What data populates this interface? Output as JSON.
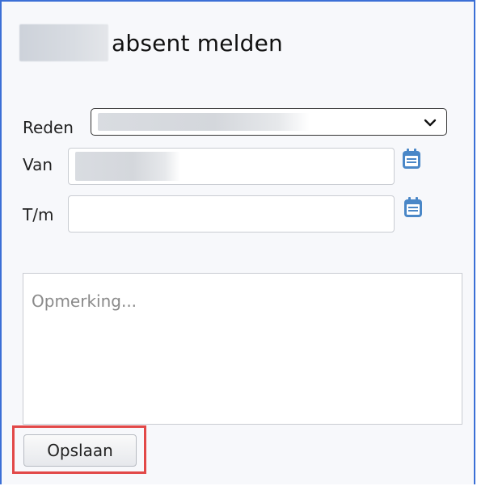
{
  "header": {
    "title": "absent melden"
  },
  "form": {
    "reason_label": "Reden",
    "from_label": "Van",
    "until_label": "T/m",
    "remark_placeholder": "Opmerking..."
  },
  "actions": {
    "save_label": "Opslaan"
  },
  "icons": {
    "date_picker": "calendar-icon",
    "select_arrow": "chevron-down-icon"
  },
  "colors": {
    "border": "#3b6fd6",
    "highlight": "#e24848",
    "icon": "#4a87c7"
  }
}
